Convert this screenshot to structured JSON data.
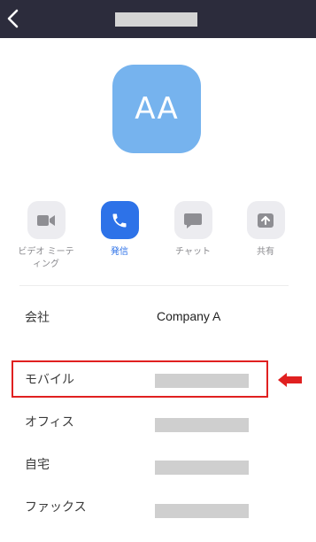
{
  "header": {
    "back_icon": "chevron-left-icon",
    "title": ""
  },
  "contact": {
    "initials": "AA",
    "avatar_color": "#76b3ee"
  },
  "actions": [
    {
      "label": "ビデオ ミーティング",
      "icon": "video-camera-icon",
      "active": false
    },
    {
      "label": "発信",
      "icon": "phone-icon",
      "active": true
    },
    {
      "label": "チャット",
      "icon": "chat-bubble-icon",
      "active": false
    },
    {
      "label": "共有",
      "icon": "share-upload-icon",
      "active": false
    }
  ],
  "details": {
    "company": {
      "label": "会社",
      "value": "Company A"
    },
    "mobile": {
      "label": "モバイル"
    },
    "office": {
      "label": "オフィス"
    },
    "home": {
      "label": "自宅"
    },
    "fax": {
      "label": "ファックス"
    }
  },
  "colors": {
    "header_bg": "#2c2c3c",
    "accent": "#2d72e8",
    "highlight": "#e02020"
  }
}
